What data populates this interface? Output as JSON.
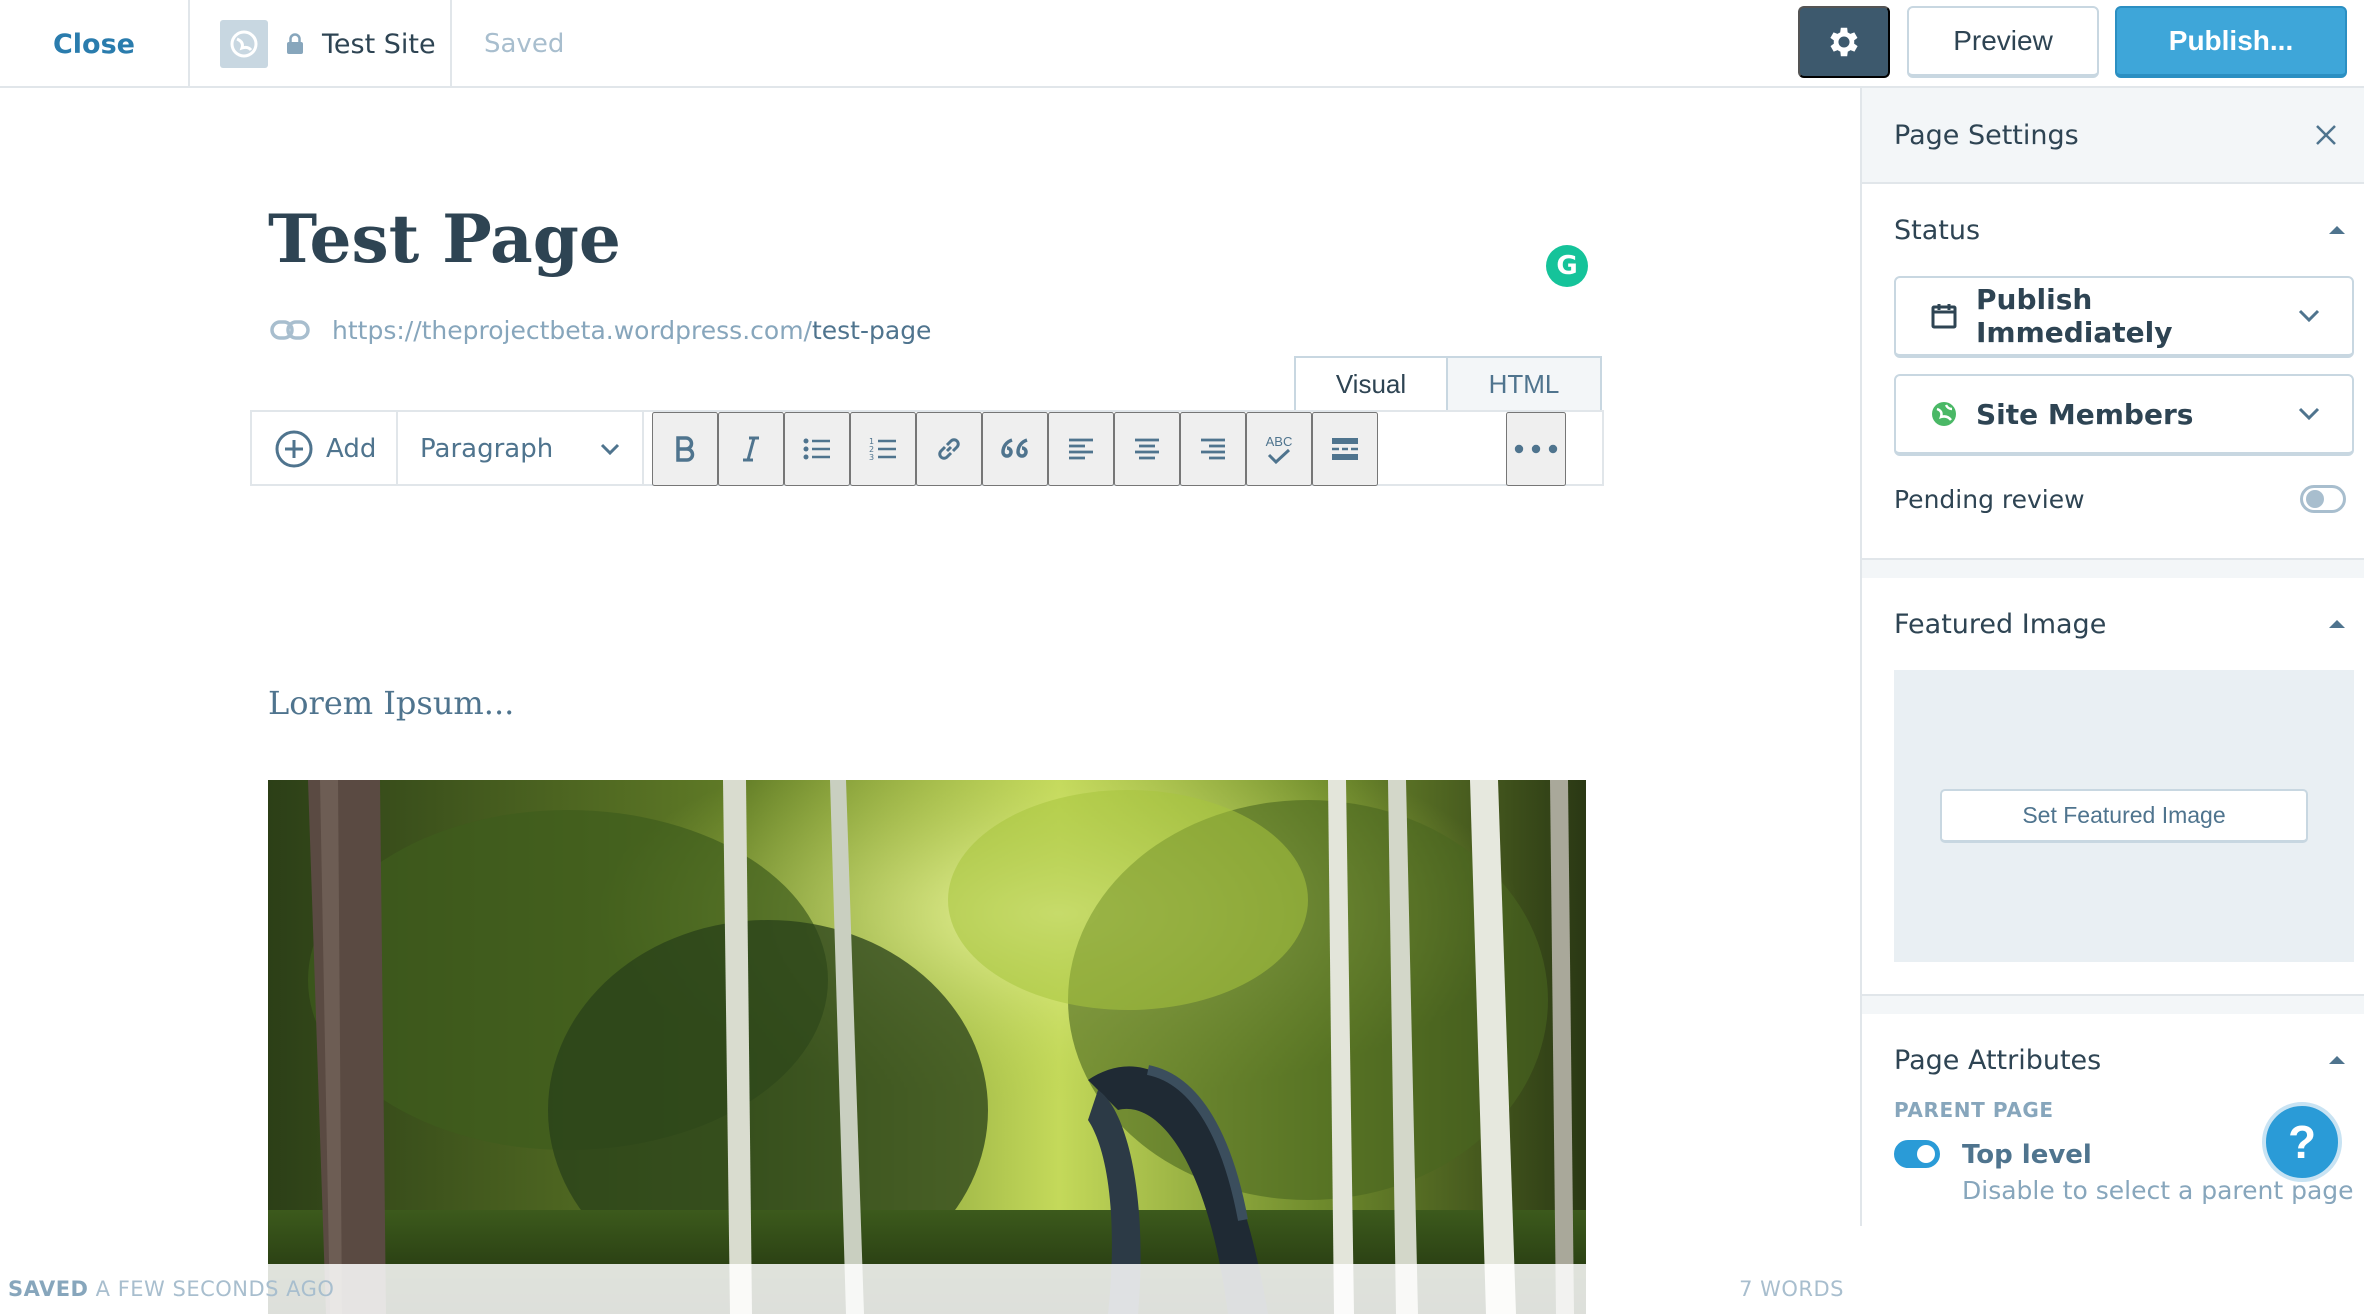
{
  "topbar": {
    "close_label": "Close",
    "site_name": "Test Site",
    "save_status": "Saved",
    "preview_label": "Preview",
    "publish_label": "Publish..."
  },
  "editor": {
    "title": "Test Page",
    "permalink_base": "https://theprojectbeta.wordpress.com/",
    "permalink_slug": "test-page",
    "tabs": [
      {
        "label": "Visual"
      },
      {
        "label": "HTML"
      }
    ],
    "toolbar": {
      "add_label": "Add",
      "format_value": "Paragraph",
      "spellcheck_text": "ABC"
    },
    "body_text": "Lorem Ipsum...",
    "grammarly_letter": "G",
    "status_saved_strong": "SAVED",
    "status_saved_rest": " A FEW SECONDS AGO",
    "word_count": "7 WORDS"
  },
  "sidebar": {
    "title": "Page Settings",
    "status": {
      "title": "Status",
      "publish_option": "Publish Immediately",
      "visibility_option": "Site Members",
      "pending_label": "Pending review",
      "pending_on": false
    },
    "featured_image": {
      "title": "Featured Image",
      "button_label": "Set Featured Image"
    },
    "page_attributes": {
      "title": "Page Attributes",
      "parent_label": "PARENT PAGE",
      "top_level_label": "Top level",
      "top_level_hint": "Disable to select a parent page",
      "top_level_on": true
    }
  },
  "help_label": "?",
  "colors": {
    "accent": "#2a9bd7",
    "publish": "#3ea6d9",
    "dark": "#2e4453",
    "muted": "#87a6bc",
    "sidebar_bg": "#f3f6f8"
  }
}
